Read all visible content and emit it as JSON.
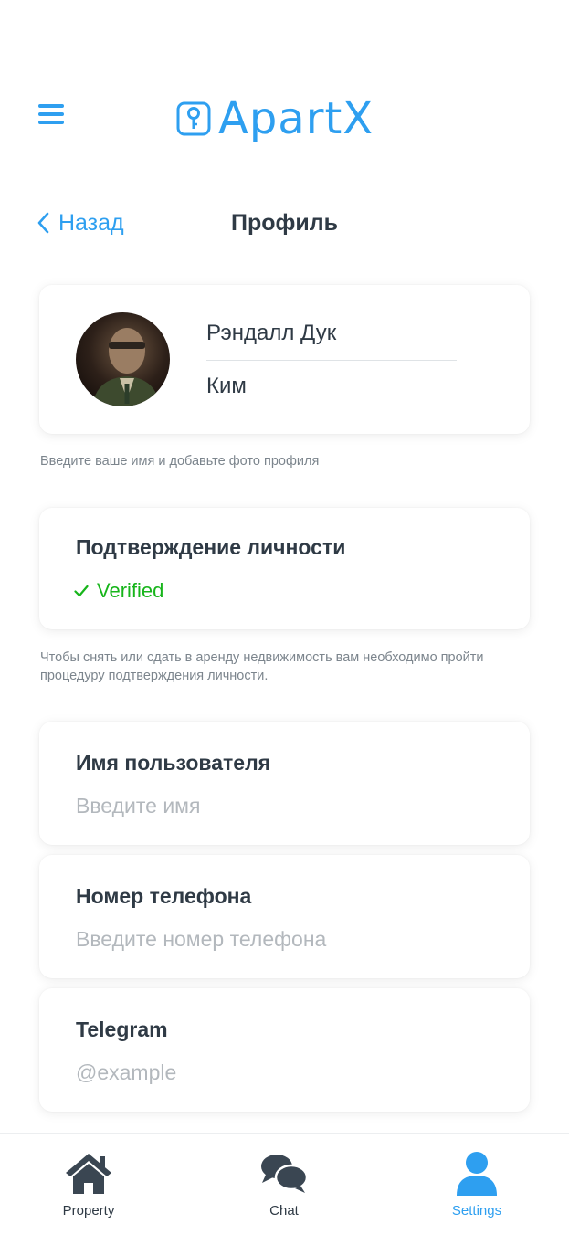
{
  "header": {
    "logo_text": "ApartX"
  },
  "nav": {
    "back_label": "Назад",
    "title": "Профиль"
  },
  "profile": {
    "first_name": "Рэндалл Дук",
    "last_name": "Ким",
    "hint": "Введите ваше имя и добавьте фото профиля"
  },
  "verification": {
    "title": "Подтверждение личности",
    "status": "Verified",
    "status_color": "#17b51b",
    "hint": "Чтобы снять или сдать в аренду недвижимость вам необходимо пройти процедуру подтверждения личности."
  },
  "fields": [
    {
      "label": "Имя пользователя",
      "placeholder": "Введите имя"
    },
    {
      "label": "Номер телефона",
      "placeholder": "Введите номер телефона"
    },
    {
      "label": "Telegram",
      "placeholder": "@example"
    }
  ],
  "tabs": [
    {
      "label": "Property",
      "icon": "home-icon"
    },
    {
      "label": "Chat",
      "icon": "chat-icon"
    },
    {
      "label": "Settings",
      "icon": "user-icon",
      "active": true
    }
  ],
  "colors": {
    "accent": "#2e9ff0",
    "text": "#2f3a45",
    "muted": "#7c858d",
    "placeholder": "#b3b8bd"
  }
}
